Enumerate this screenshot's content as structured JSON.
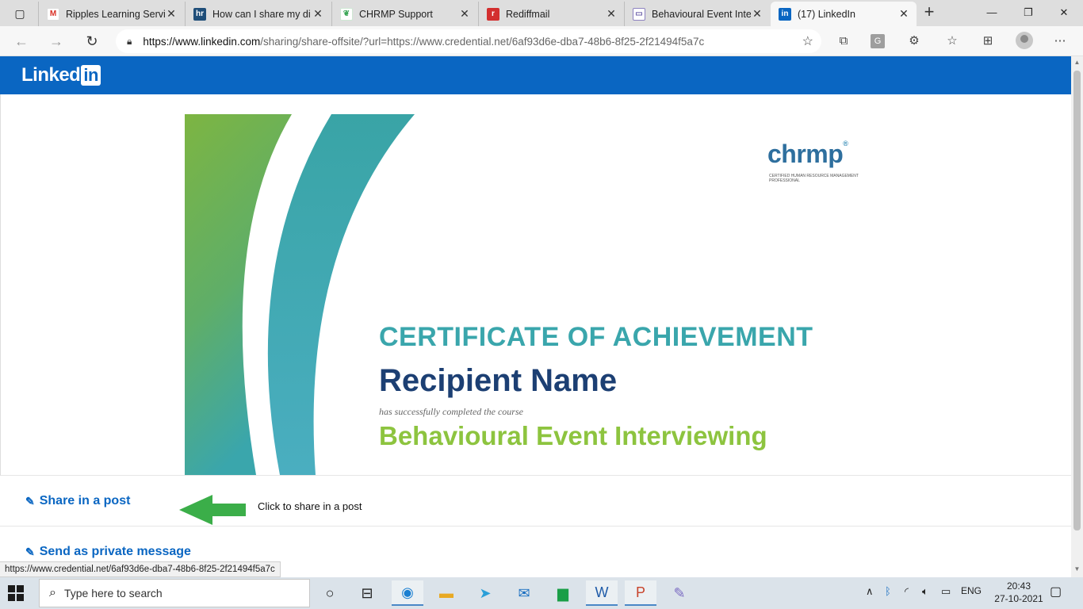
{
  "browser": {
    "tabs": [
      {
        "title": "Ripples Learning Servi",
        "icon": "gmail-icon",
        "active": false
      },
      {
        "title": "How can I share my di",
        "icon": "hr-icon",
        "active": false
      },
      {
        "title": "CHRMP Support",
        "icon": "chrmp-support-icon",
        "active": false
      },
      {
        "title": "Rediffmail",
        "icon": "rediffmail-icon",
        "active": false
      },
      {
        "title": "Behavioural Event Inte",
        "icon": "mail-icon",
        "active": false
      },
      {
        "title": "(17) LinkedIn",
        "icon": "linkedin-icon",
        "active": true
      }
    ],
    "url_host": "https://www.linkedin.com",
    "url_path": "/sharing/share-offsite/?url=https://www.credential.net/6af93d6e-dba7-48b6-8f25-2f21494f5a7c",
    "status_url": "https://www.credential.net/6af93d6e-dba7-48b6-8f25-2f21494f5a7c",
    "extension_letter": "G"
  },
  "linkedin": {
    "logo_text": "Linked",
    "logo_in": "in",
    "brand_color": "#0a66c2"
  },
  "certificate": {
    "brand": "chrmp",
    "brand_mark": "®",
    "brand_subtitle": "CERTIFIED HUMAN RESOURCE MANAGEMENT PROFESSIONAL",
    "title": "CERTIFICATE OF ACHIEVEMENT",
    "recipient": "Recipient Name",
    "subtitle": "has successfully completed the course",
    "course": "Behavioural Event Interviewing"
  },
  "actions": {
    "share_post": "Share in a post",
    "private_message": "Send as private message"
  },
  "annotation": "Click to share in a post",
  "taskbar": {
    "search_placeholder": "Type here to search",
    "language": "ENG",
    "time": "20:43",
    "date": "27-10-2021"
  }
}
